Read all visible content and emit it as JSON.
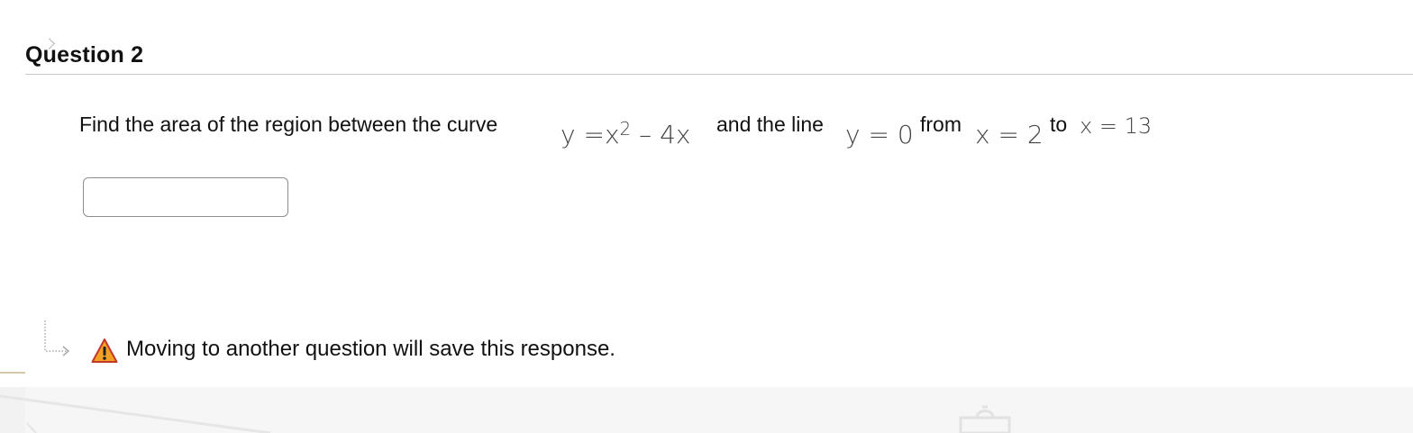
{
  "question": {
    "title": "Question 2"
  },
  "prompt": {
    "text_intro": "Find the area of the region between the curve",
    "curve_y": "y",
    "curve_eq": "=",
    "curve_x": "x",
    "curve_exp": "2",
    "curve_rest": "– 4x",
    "text_line": "and the line",
    "line_eq": "y = 0",
    "text_from": "from",
    "from_eq": "x = 2",
    "text_to": "to",
    "to_eq": "x = 13"
  },
  "answer": {
    "value": "",
    "placeholder": ""
  },
  "notice": {
    "warning_text": "Moving to another question will save this response."
  },
  "icons": {
    "warning": "warning-triangle-icon",
    "arrow": "dotted-return-arrow-icon",
    "bag": "bag-icon"
  },
  "colors": {
    "warning_fill": "#f3a024",
    "warning_stroke": "#c0392b",
    "divider": "#c9c9c9",
    "input_border": "#8d8d8d",
    "footer_bg": "#f6f6f6"
  }
}
